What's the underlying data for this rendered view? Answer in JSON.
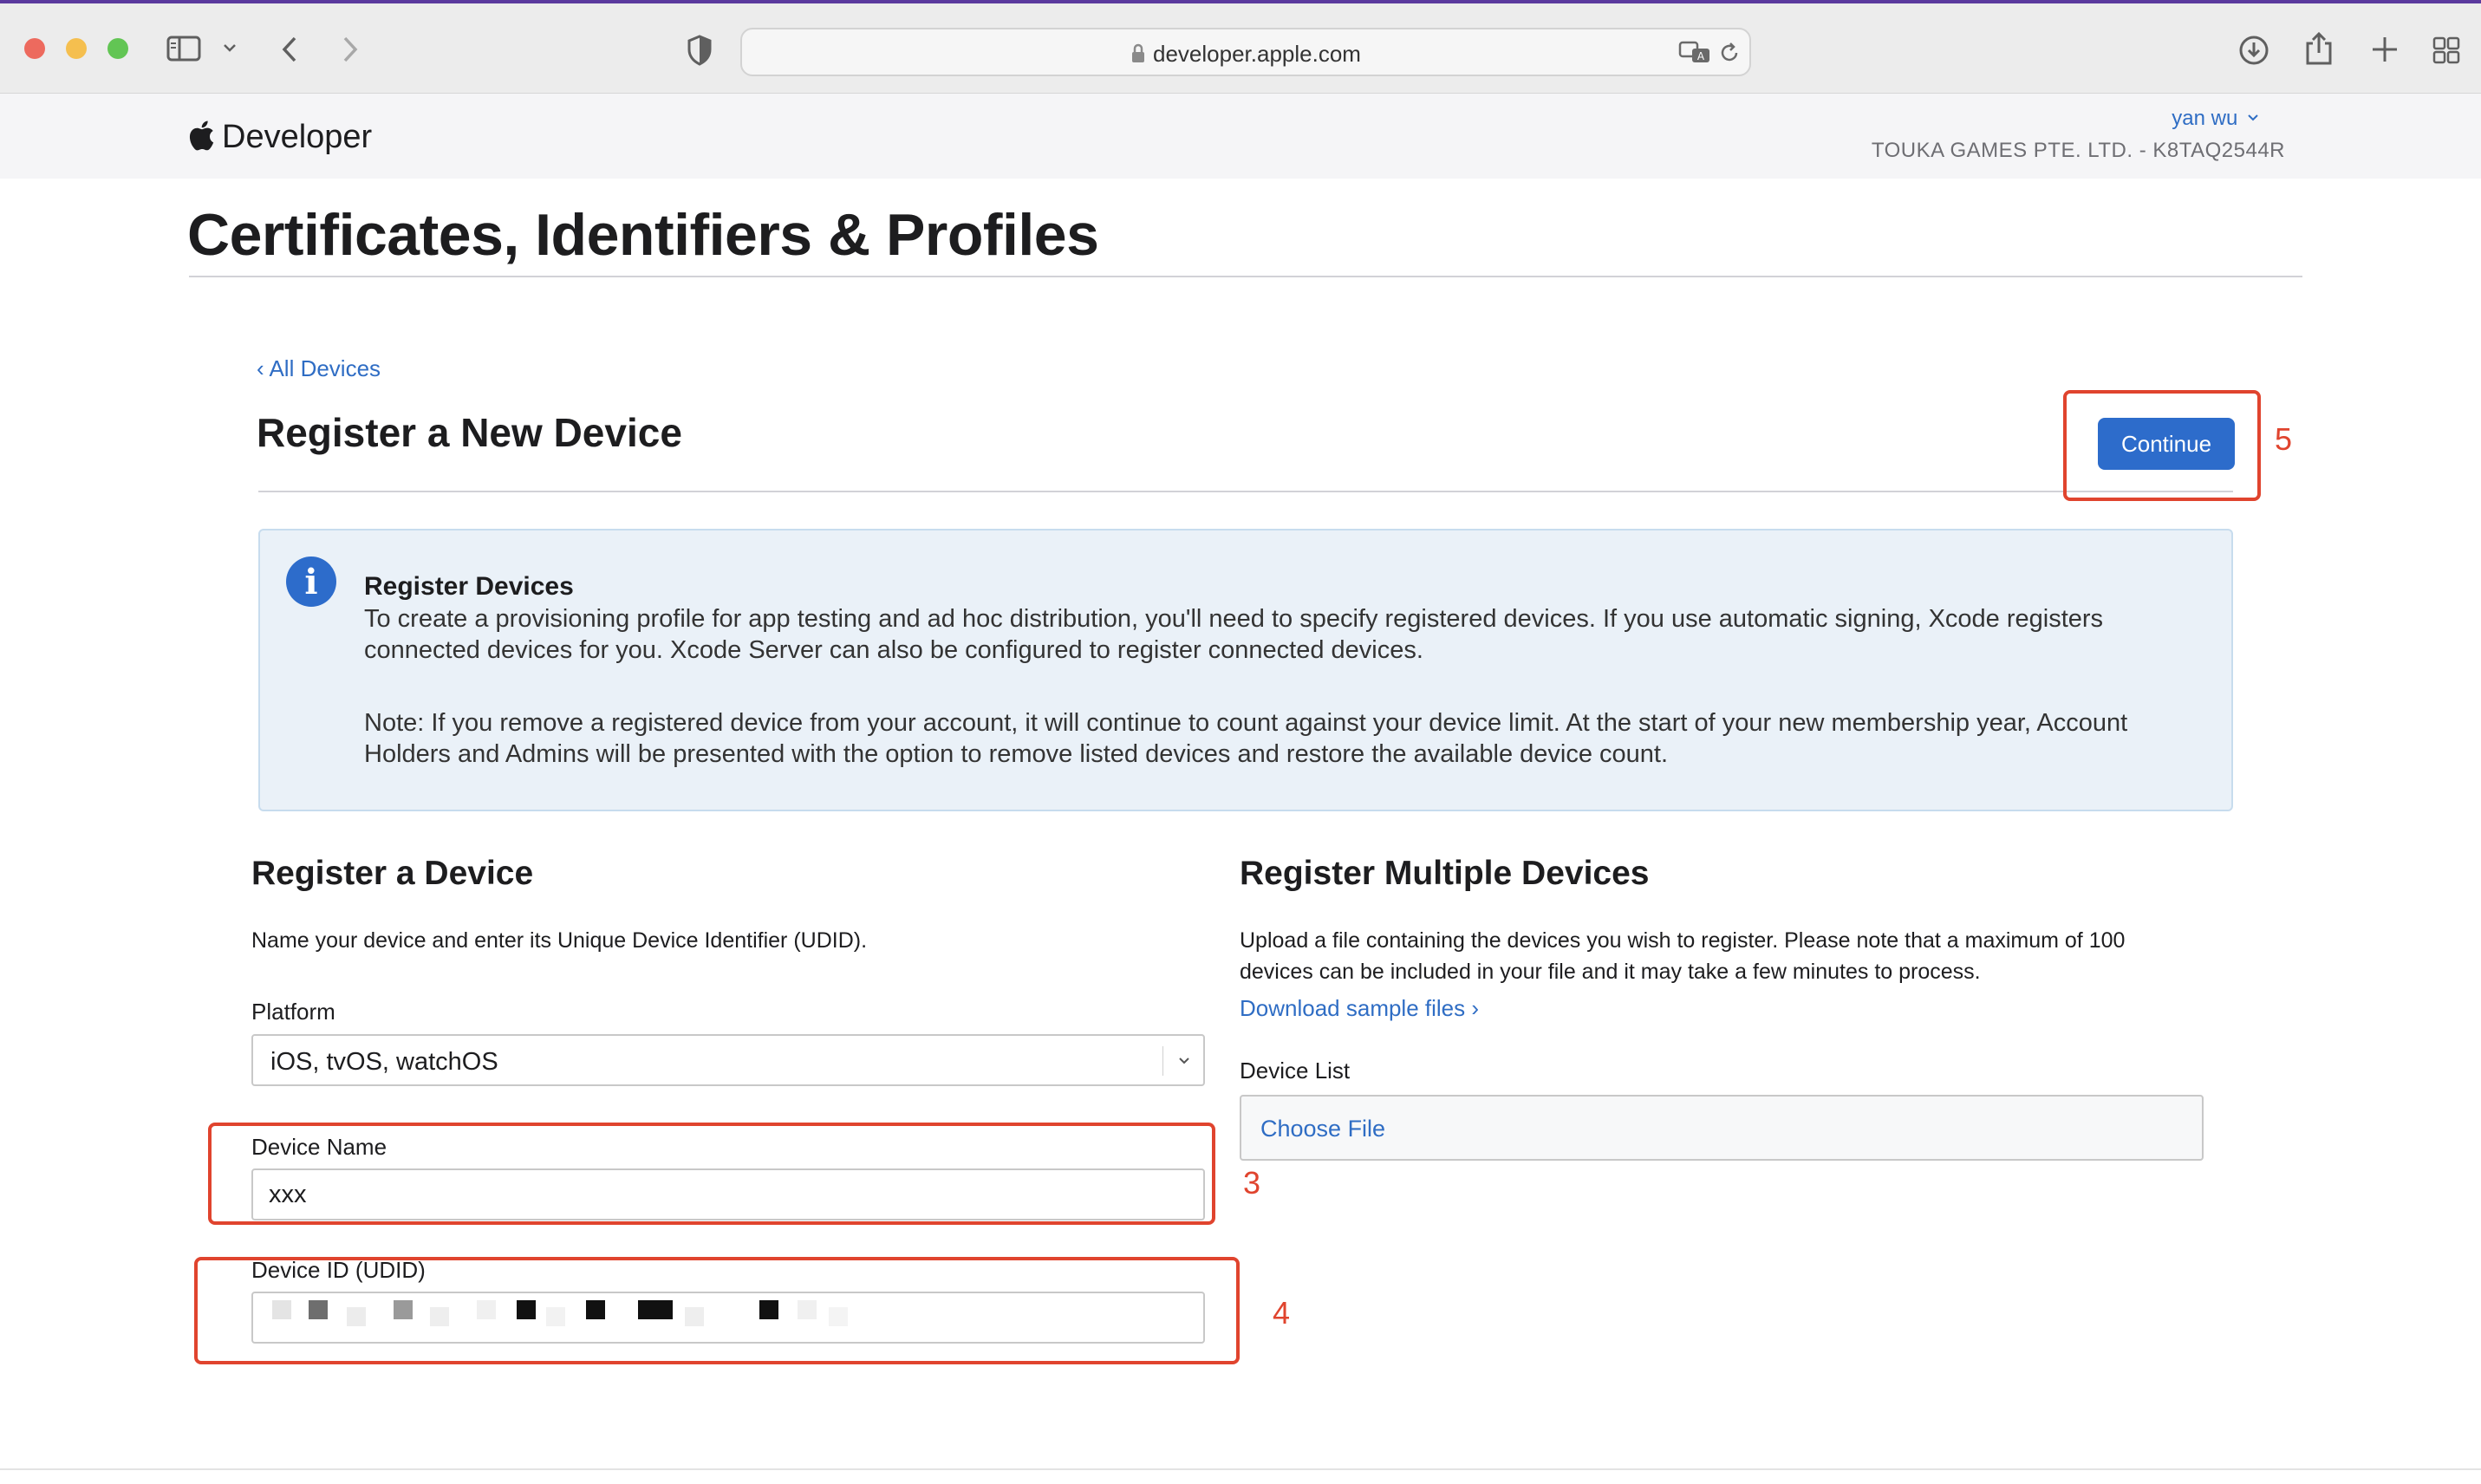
{
  "browser": {
    "url": "developer.apple.com",
    "colors": {
      "close": "#ed6a5e",
      "minimize": "#f5bf4f",
      "zoom": "#62c554"
    }
  },
  "header": {
    "brand": "Developer",
    "user": "yan wu",
    "team": "TOUKA GAMES PTE. LTD. - K8TAQ2544R"
  },
  "page": {
    "title": "Certificates, Identifiers & Profiles",
    "back_link": "‹ All Devices",
    "section_title": "Register a New Device",
    "continue_label": "Continue"
  },
  "info": {
    "heading": "Register Devices",
    "paragraph1": "To create a provisioning profile for app testing and ad hoc distribution, you'll need to specify registered devices. If you use automatic signing, Xcode registers connected devices for you. Xcode Server can also be configured to register connected devices.",
    "paragraph2": "Note: If you remove a registered device from your account, it will continue to count against your device limit. At the start of your new membership year, Account Holders and Admins will be presented with the option to remove listed devices and restore the available device count."
  },
  "register_device": {
    "title": "Register a Device",
    "description": "Name your device and enter its Unique Device Identifier (UDID).",
    "platform_label": "Platform",
    "platform_value": "iOS, tvOS, watchOS",
    "device_name_label": "Device Name",
    "device_name_value": "xxx",
    "device_id_label": "Device ID (UDID)"
  },
  "register_multiple": {
    "title": "Register Multiple Devices",
    "description": "Upload a file containing the devices you wish to register. Please note that a maximum of 100 devices can be included in your file and it may take a few minutes to process.",
    "download_link": "Download sample files ›",
    "device_list_label": "Device List",
    "choose_file_label": "Choose File"
  },
  "annotations": {
    "step3": "3",
    "step4": "4",
    "step5": "5",
    "color": "#e0442e"
  }
}
